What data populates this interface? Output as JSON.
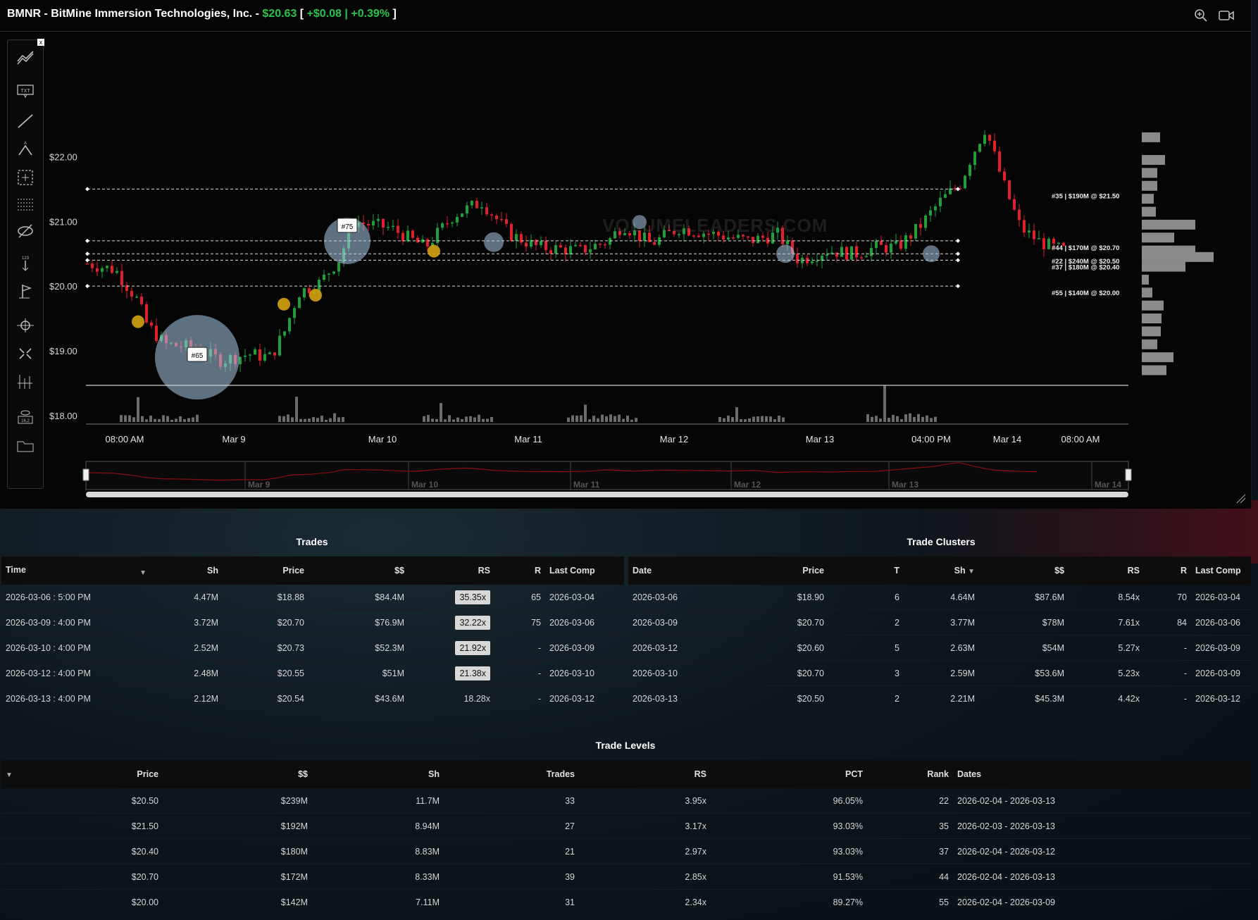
{
  "header": {
    "ticker": "BMNR",
    "company": "BitMine Immersion Technologies, Inc.",
    "price": "$20.63",
    "change": "+$0.08",
    "change_pct": "+0.39%"
  },
  "chart_data": {
    "type": "line",
    "title": "",
    "y_ticks": [
      "$22.00",
      "$21.00",
      "$20.00",
      "$19.00",
      "$18.00"
    ],
    "x_ticks": [
      "08:00 AM",
      "Mar 9",
      "Mar 10",
      "Mar 11",
      "Mar 12",
      "Mar 13",
      "04:00 PM",
      "Mar 14",
      "08:00 AM"
    ],
    "navigator_ticks": [
      "Mar 9",
      "Mar 10",
      "Mar 11",
      "Mar 12",
      "Mar 13",
      "Mar 14"
    ],
    "watermark": "VOLUMELEADERS.COM",
    "levels": [
      {
        "label": "#35 | $190M @ $21.50",
        "price": 21.5
      },
      {
        "label": "#44 | $170M @ $20.70",
        "price": 20.7
      },
      {
        "label": "#22 | $240M @ $20.50",
        "price": 20.5
      },
      {
        "label": "#37 | $180M @ $20.40",
        "price": 20.4
      },
      {
        "label": "#55 | $140M @ $20.00",
        "price": 20.0
      }
    ],
    "markers": [
      {
        "label": "#75",
        "price": 20.7,
        "session": "Mar 9 4:00 PM"
      },
      {
        "label": "#65",
        "price": 18.88,
        "session": "Mar 6 5:00 PM"
      }
    ],
    "ylim": [
      17.9,
      22.8
    ],
    "grid": false,
    "colors": {
      "up": "#1f9e3a",
      "down": "#e0202b",
      "bubble": "#a9c9e6",
      "level": "#ffffff"
    }
  },
  "trades": {
    "title": "Trades",
    "columns": [
      "Time",
      "Sh",
      "Price",
      "$$",
      "RS",
      "R",
      "Last Comp"
    ],
    "rows": [
      {
        "time": "2026-03-06 : 5:00 PM",
        "sh": "4.47M",
        "price": "$18.88",
        "dollars": "$84.4M",
        "rs": "35.35x",
        "r": "65",
        "last": "2026-03-04"
      },
      {
        "time": "2026-03-09 : 4:00 PM",
        "sh": "3.72M",
        "price": "$20.70",
        "dollars": "$76.9M",
        "rs": "32.22x",
        "r": "75",
        "last": "2026-03-06"
      },
      {
        "time": "2026-03-10 : 4:00 PM",
        "sh": "2.52M",
        "price": "$20.73",
        "dollars": "$52.3M",
        "rs": "21.92x",
        "r": "-",
        "last": "2026-03-09"
      },
      {
        "time": "2026-03-12 : 4:00 PM",
        "sh": "2.48M",
        "price": "$20.55",
        "dollars": "$51M",
        "rs": "21.38x",
        "r": "-",
        "last": "2026-03-10"
      },
      {
        "time": "2026-03-13 : 4:00 PM",
        "sh": "2.12M",
        "price": "$20.54",
        "dollars": "$43.6M",
        "rs": "18.28x",
        "r": "-",
        "last": "2026-03-12"
      }
    ]
  },
  "clusters": {
    "title": "Trade Clusters",
    "columns": [
      "Date",
      "Price",
      "T",
      "Sh",
      "$$",
      "RS",
      "R",
      "Last Comp"
    ],
    "rows": [
      {
        "date": "2026-03-06",
        "price": "$18.90",
        "t": "6",
        "sh": "4.64M",
        "dollars": "$87.6M",
        "rs": "8.54x",
        "r": "70",
        "last": "2026-03-04"
      },
      {
        "date": "2026-03-09",
        "price": "$20.70",
        "t": "2",
        "sh": "3.77M",
        "dollars": "$78M",
        "rs": "7.61x",
        "r": "84",
        "last": "2026-03-06"
      },
      {
        "date": "2026-03-12",
        "price": "$20.60",
        "t": "5",
        "sh": "2.63M",
        "dollars": "$54M",
        "rs": "5.27x",
        "r": "-",
        "last": "2026-03-09"
      },
      {
        "date": "2026-03-10",
        "price": "$20.70",
        "t": "3",
        "sh": "2.59M",
        "dollars": "$53.6M",
        "rs": "5.23x",
        "r": "-",
        "last": "2026-03-09"
      },
      {
        "date": "2026-03-13",
        "price": "$20.50",
        "t": "2",
        "sh": "2.21M",
        "dollars": "$45.3M",
        "rs": "4.42x",
        "r": "-",
        "last": "2026-03-12"
      }
    ]
  },
  "levels": {
    "title": "Trade Levels",
    "columns": [
      "Price",
      "$$",
      "Sh",
      "Trades",
      "RS",
      "PCT",
      "Rank",
      "Dates"
    ],
    "rows": [
      {
        "price": "$20.50",
        "dollars": "$239M",
        "sh": "11.7M",
        "trades": "33",
        "rs": "3.95x",
        "pct": "96.05%",
        "rank": "22",
        "dates": "2026-02-04 - 2026-03-13"
      },
      {
        "price": "$21.50",
        "dollars": "$192M",
        "sh": "8.94M",
        "trades": "27",
        "rs": "3.17x",
        "pct": "93.03%",
        "rank": "35",
        "dates": "2026-02-03 - 2026-03-13"
      },
      {
        "price": "$20.40",
        "dollars": "$180M",
        "sh": "8.83M",
        "trades": "21",
        "rs": "2.97x",
        "pct": "93.03%",
        "rank": "37",
        "dates": "2026-02-04 - 2026-03-12"
      },
      {
        "price": "$20.70",
        "dollars": "$172M",
        "sh": "8.33M",
        "trades": "39",
        "rs": "2.85x",
        "pct": "91.53%",
        "rank": "44",
        "dates": "2026-02-04 - 2026-03-13"
      },
      {
        "price": "$20.00",
        "dollars": "$142M",
        "sh": "7.11M",
        "trades": "31",
        "rs": "2.34x",
        "pct": "89.27%",
        "rank": "55",
        "dates": "2026-02-04 - 2026-03-09"
      }
    ]
  }
}
